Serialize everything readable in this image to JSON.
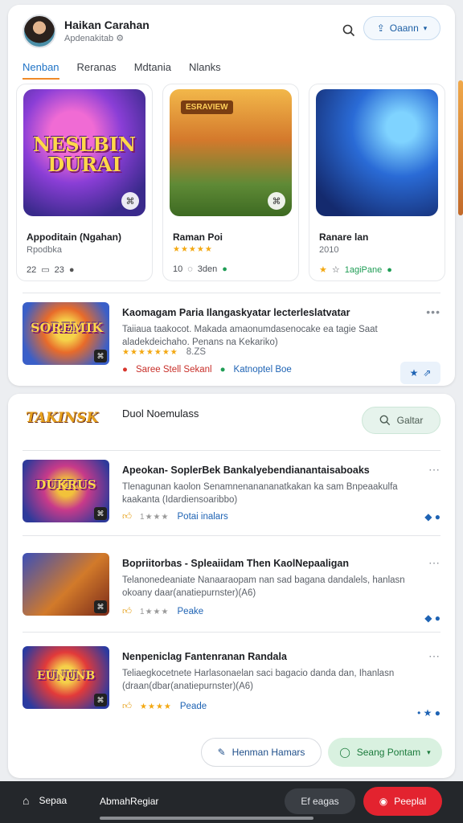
{
  "header": {
    "user_name": "Haikan Carahan",
    "user_sub": "Apdenakitab",
    "open_label": "Oaann"
  },
  "tabs": [
    "Nenban",
    "Reranas",
    "Mdtania",
    "Nlanks"
  ],
  "games": [
    {
      "thumb_text": "NESLBIN DURAI",
      "title": "Appoditain (Ngahan)",
      "sub": "Rpodbka",
      "stat1": "22",
      "stat2": "23"
    },
    {
      "thumb_text": "ESRAVIEW",
      "title": "Raman Poi",
      "sub": "",
      "stat1": "10",
      "stat2": "3den"
    },
    {
      "thumb_text": "",
      "title": "Ranare lan",
      "sub": "2010",
      "stat1": "",
      "stat2": "1agiPane"
    }
  ],
  "featured": {
    "thumb_text": "SOREMIK",
    "title": "Kaomagam Paria Ilangaskyatar lecterleslatvatar",
    "desc": "Taiiaua taakocot. Makada amaonumdasenocake ea tagie Saat aladekdeichaho. Penans na Kekariko)",
    "rating": "8.ZS",
    "tag1": "Saree Stell Sekanl",
    "tag2": "Katnoptel Boe"
  },
  "section": {
    "logo_text": "TAKINSK",
    "title": "Duol Noemulass",
    "search_label": "Galtar"
  },
  "list_items": [
    {
      "thumb_text": "DUKRUS",
      "title": "Apeokan- SoplerBek Bankalyebendianantaisaboaks",
      "desc": "Tlenagunan kaolon Senamnenanananatkakan ka sam Bnpeaakulfa kaakanta (Idardiensoaribbo)",
      "link": "Potai inalars"
    },
    {
      "thumb_text": "",
      "title": "Bopriitorbas - Spleaiidam Then KaolNepaaligan",
      "desc": "Telanonedeaniate Nanaaraopam nan sad bagana dandalels, hanlasn okoany daar(anatiepurnster)(A6)",
      "link": "Peake"
    },
    {
      "thumb_text": "EUNUNB",
      "title": "Nenpeniclag Fantenranan Randala",
      "desc": "Teliaegkocetnete Harlasonaelan saci bagacio danda dan, Ihanlasn (draan(dbar(anatiepurnster)(A6)",
      "link": "Peade"
    }
  ],
  "actions": {
    "left_label": "Henman Hamars",
    "right_label": "Seang Pontam"
  },
  "bottom": {
    "home_label": "Sepaa",
    "mid_label": "AbmahRegiar",
    "pill_label": "Ef eagas",
    "cta_label": "Peeplal"
  }
}
